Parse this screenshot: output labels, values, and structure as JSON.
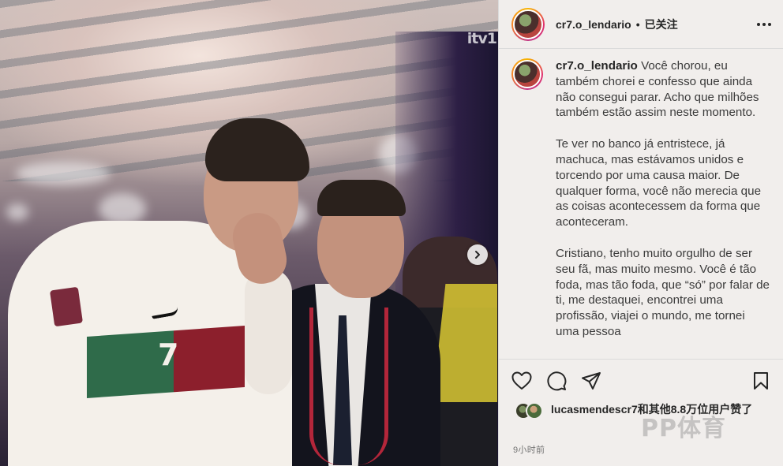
{
  "post": {
    "media_watermark": "itv1",
    "author": {
      "username": "cr7.o_lendario",
      "separator": "•",
      "follow_state": "已关注"
    },
    "caption": {
      "username": "cr7.o_lendario",
      "paragraphs": [
        "Você chorou, eu também chorei e confesso que ainda não consegui parar. Acho que milhões também estão assim neste momento.",
        "Te ver no banco já entristece, já machuca, mas estávamos unidos e torcendo por uma causa maior. De qualquer forma, você não merecia que as coisas acontecessem da forma que aconteceram.",
        "Cristiano, tenho muito orgulho de ser seu fã, mas muito mesmo. Você é tão foda, mas tão foda, que “só” por falar de ti, me destaquei, encontrei uma profissão, viajei o mundo, me tornei uma pessoa"
      ]
    },
    "likes": {
      "user": "lucasmendescr7",
      "rest": "和其他8.8万位用户赞了"
    },
    "timestamp": "9小时前",
    "site_watermark": "PP体育",
    "icons": [
      "heart-icon",
      "comment-icon",
      "share-icon",
      "bookmark-icon",
      "more-options-icon",
      "chevron-right-icon"
    ]
  }
}
